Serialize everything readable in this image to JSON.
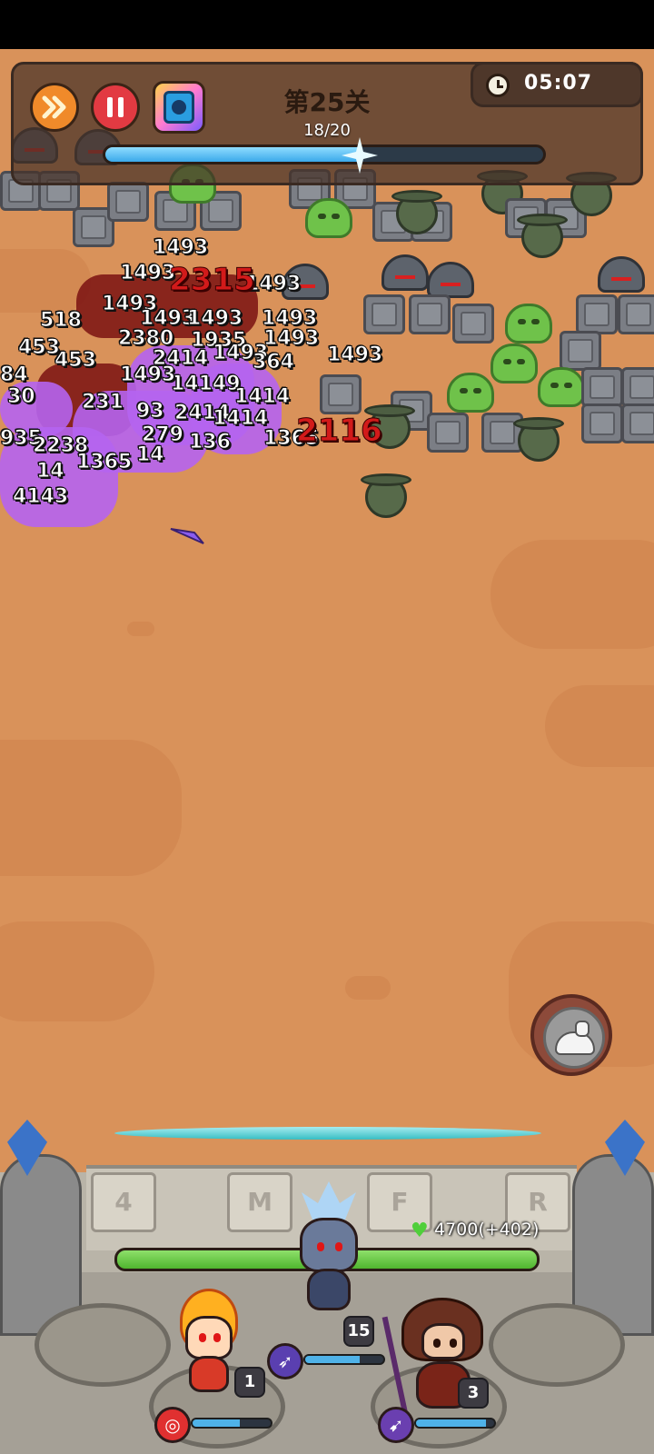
{
  "hud": {
    "fast_forward_icon": "fast-forward-icon",
    "pause_icon": "pause-icon",
    "skill_icon": "hero-skill-card-icon",
    "stage_title": "第25关",
    "wave_progress_text": "18/20",
    "wave_progress": 0.58,
    "timer_icon": "clock-icon",
    "timer": "05:07"
  },
  "damage_numbers": {
    "n01": "1493",
    "n02": "1493",
    "n03": "1493",
    "n04": "1493",
    "n05": "1493",
    "n06": "1493",
    "n07": "1493",
    "n08": "1493",
    "n09": "1493",
    "n10": "518",
    "n11": "453",
    "n12": "2380",
    "n13": "1935",
    "n14": "1493",
    "n15": "453",
    "n16": "2414",
    "n17": "84",
    "n18": "14149",
    "n19": "30",
    "n20": "1414",
    "n21": "231",
    "n22": "93",
    "n23": "2414",
    "n24": "1414",
    "n25": "935",
    "n26": "2238",
    "n27": "279",
    "n28": "136",
    "n29": "14",
    "n30": "1365",
    "n31": "1365",
    "n32": "14",
    "n33": "4143",
    "n34": "364",
    "n35": "1493",
    "crit1": "2315",
    "crit2": "2116"
  },
  "roast_button_icon": "roast-chicken-icon",
  "wall": {
    "hp_text": "4700(+402)",
    "hp_fraction": 1.0,
    "heart_icon": "heart-icon"
  },
  "heroes": [
    {
      "name_icon": "fire-spirit-hero",
      "level": "1",
      "skill_icon": "target-skill-icon",
      "energy": 0.6
    },
    {
      "name_icon": "dark-elf-archer-hero",
      "level": "15",
      "skill_icon": "arrow-volley-skill-icon",
      "energy": 0.7
    },
    {
      "name_icon": "hooded-mage-hero",
      "level": "3",
      "skill_icon": "arrow-skill-icon",
      "energy": 0.9
    }
  ],
  "colors": {
    "ground": "#d9925a",
    "accent_blue": "#3ba9ea",
    "hp_green": "#4fb52e",
    "crit_red": "#d21a1a"
  }
}
